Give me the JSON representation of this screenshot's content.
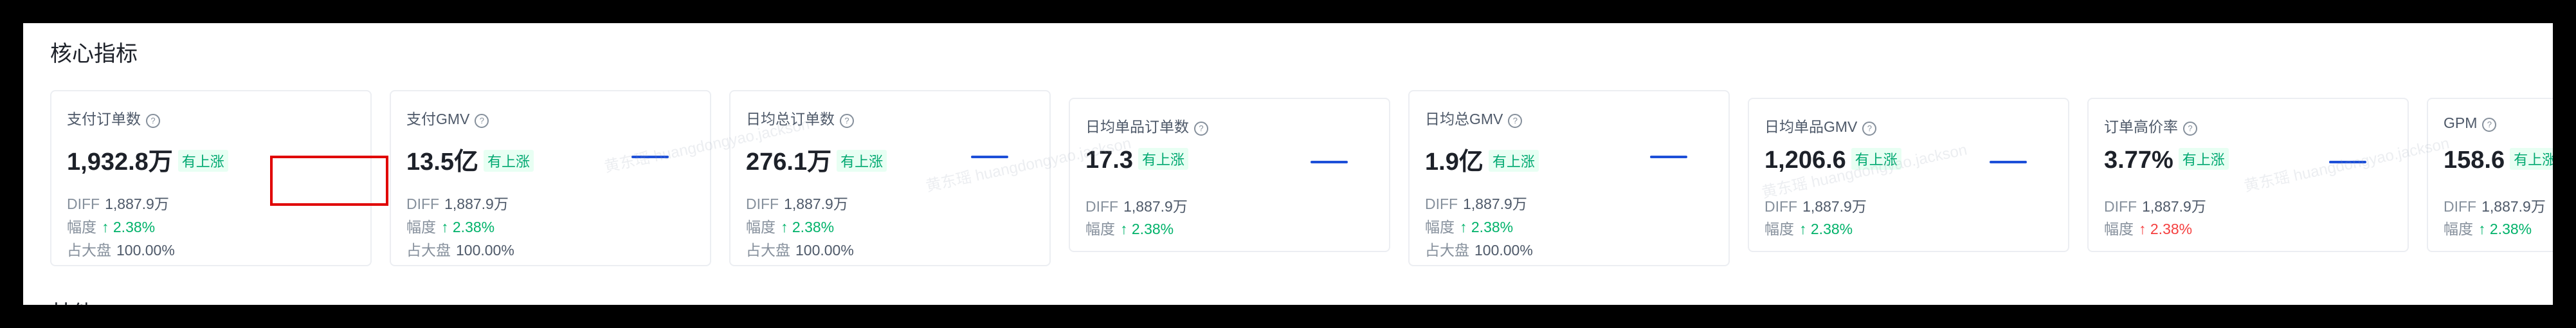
{
  "section_title": "核心指标",
  "next_section_title": "其他",
  "watermark_text": "黄东瑶 huangdongyao.jackson",
  "cards": [
    {
      "title": "支付订单数",
      "value": "1,932.8万",
      "badge": "有上涨",
      "diff_label": "DIFF",
      "diff_value": "1,887.9万",
      "change_label": "幅度",
      "change_value": "↑ 2.38%",
      "share_label": "占大盘",
      "share_value": "100.00%"
    },
    {
      "title": "支付GMV",
      "value": "13.5亿",
      "badge": "有上涨",
      "diff_label": "DIFF",
      "diff_value": "1,887.9万",
      "change_label": "幅度",
      "change_value": "↑ 2.38%",
      "share_label": "占大盘",
      "share_value": "100.00%"
    },
    {
      "title": "日均总订单数",
      "value": "276.1万",
      "badge": "有上涨",
      "diff_label": "DIFF",
      "diff_value": "1,887.9万",
      "change_label": "幅度",
      "change_value": "↑ 2.38%",
      "share_label": "占大盘",
      "share_value": "100.00%"
    },
    {
      "title": "日均单品订单数",
      "value": "17.3",
      "badge": "有上涨",
      "diff_label": "DIFF",
      "diff_value": "1,887.9万",
      "change_label": "幅度",
      "change_value": "↑ 2.38%"
    },
    {
      "title": "日均总GMV",
      "value": "1.9亿",
      "badge": "有上涨",
      "diff_label": "DIFF",
      "diff_value": "1,887.9万",
      "change_label": "幅度",
      "change_value": "↑ 2.38%",
      "share_label": "占大盘",
      "share_value": "100.00%"
    },
    {
      "title": "日均单品GMV",
      "value": "1,206.6",
      "badge": "有上涨",
      "diff_label": "DIFF",
      "diff_value": "1,887.9万",
      "change_label": "幅度",
      "change_value": "↑ 2.38%"
    },
    {
      "title": "订单高价率",
      "value": "3.77%",
      "badge": "有上涨",
      "diff_label": "DIFF",
      "diff_value": "1,887.9万",
      "change_label": "幅度",
      "change_value": "↑ 2.38%",
      "change_color": "#f53f3f"
    },
    {
      "title": "GPM",
      "value": "158.6",
      "badge": "有上涨",
      "diff_label": "DIFF",
      "diff_value": "1,887.9万",
      "change_label": "幅度",
      "change_value": "↑ 2.38%"
    }
  ],
  "colors": {
    "up": "#00b26a",
    "down": "#f53f3f",
    "badge_bg": "#e8fff3",
    "sparkline": "#1d4fd8",
    "highlight": "#e00000"
  }
}
